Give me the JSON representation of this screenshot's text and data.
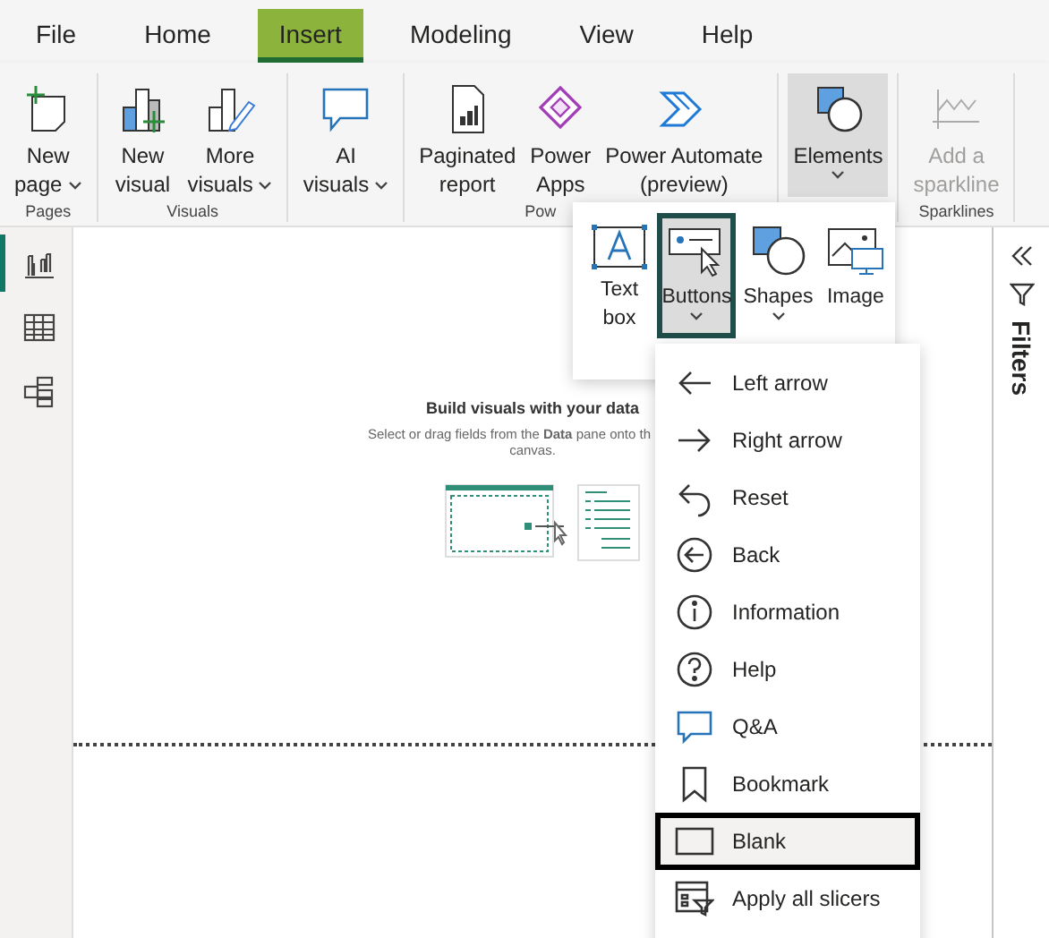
{
  "menu": [
    {
      "label": "File",
      "selected": false
    },
    {
      "label": "Home",
      "selected": false
    },
    {
      "label": "Insert",
      "selected": true
    },
    {
      "label": "Modeling",
      "selected": false
    },
    {
      "label": "View",
      "selected": false
    },
    {
      "label": "Help",
      "selected": false
    }
  ],
  "ribbon": {
    "groups": [
      {
        "label": "Pages",
        "buttons": [
          {
            "lines": [
              "New",
              "page"
            ],
            "dropdown": true,
            "selected": false,
            "disabled": false
          }
        ]
      },
      {
        "label": "Visuals",
        "buttons": [
          {
            "lines": [
              "New",
              "visual"
            ],
            "dropdown": false,
            "selected": false,
            "disabled": false
          },
          {
            "lines": [
              "More",
              "visuals"
            ],
            "dropdown": true,
            "selected": false,
            "disabled": false
          }
        ]
      },
      {
        "buttons": [
          {
            "lines": [
              "AI",
              "visuals"
            ],
            "dropdown": true,
            "selected": false,
            "disabled": false
          }
        ]
      },
      {
        "label": "Pow",
        "buttons": [
          {
            "lines": [
              "Paginated",
              "report"
            ],
            "dropdown": false,
            "selected": false,
            "disabled": false
          },
          {
            "lines": [
              "Power",
              "Apps"
            ],
            "dropdown": false,
            "selected": false,
            "disabled": false
          },
          {
            "lines": [
              "Power Automate",
              "(preview)"
            ],
            "dropdown": false,
            "selected": false,
            "disabled": false
          }
        ]
      },
      {
        "buttons": [
          {
            "lines": [
              "Elements"
            ],
            "dropdown": true,
            "selected": true,
            "disabled": false
          }
        ]
      },
      {
        "label": "Sparklines",
        "buttons": [
          {
            "lines": [
              "Add a",
              "sparkline"
            ],
            "dropdown": false,
            "selected": false,
            "disabled": true
          }
        ]
      }
    ]
  },
  "views": [
    {
      "selected": true
    },
    {
      "selected": false
    },
    {
      "selected": false
    }
  ],
  "canvas": {
    "title": "Build visuals with your data",
    "hint_line_1": "Select or drag fields from the **Data** pane onto th",
    "hint_line_2": "canvas."
  },
  "filters_pane": {
    "label": "Filters"
  },
  "elements_popup": [
    {
      "lines": [
        "Text",
        "box"
      ],
      "dropdown": false,
      "selected": false
    },
    {
      "lines": [
        "Buttons"
      ],
      "dropdown": true,
      "selected": true
    },
    {
      "lines": [
        "Shapes"
      ],
      "dropdown": true,
      "selected": false
    },
    {
      "lines": [
        "Image"
      ],
      "dropdown": false,
      "selected": false
    }
  ],
  "buttons_menu": [
    {
      "label": "Left arrow",
      "selected": false
    },
    {
      "label": "Right arrow",
      "selected": false
    },
    {
      "label": "Reset",
      "selected": false
    },
    {
      "label": "Back",
      "selected": false
    },
    {
      "label": "Information",
      "selected": false
    },
    {
      "label": "Help",
      "selected": false
    },
    {
      "label": "Q&A",
      "selected": false
    },
    {
      "label": "Bookmark",
      "selected": false
    },
    {
      "label": "Blank",
      "selected": true
    },
    {
      "label": "Apply all slicers",
      "selected": false
    }
  ]
}
